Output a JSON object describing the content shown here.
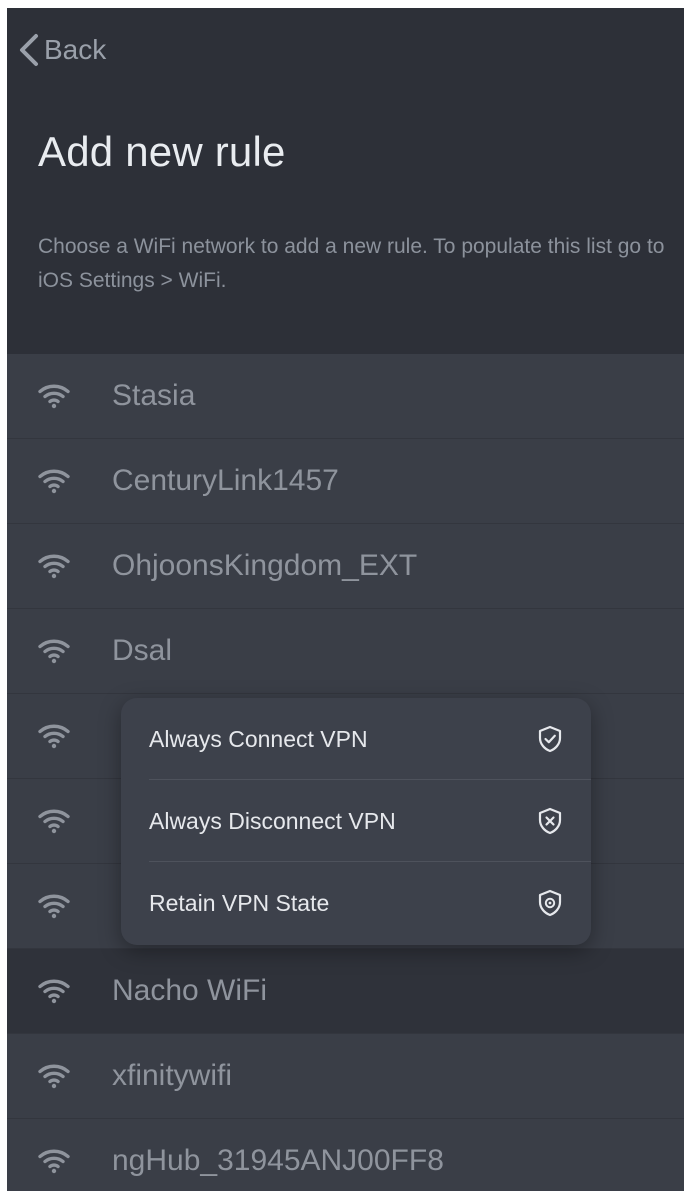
{
  "nav": {
    "back_label": "Back"
  },
  "header": {
    "title": "Add new rule",
    "subtitle": "Choose a WiFi network to add a new rule. To populate this list go to iOS Settings > WiFi."
  },
  "networks": [
    {
      "name": "Stasia",
      "icon": "wifi-icon"
    },
    {
      "name": "CenturyLink1457",
      "icon": "wifi-icon"
    },
    {
      "name": "OhjoonsKingdom_EXT",
      "icon": "wifi-icon"
    },
    {
      "name": "Dsal",
      "icon": "wifi-icon"
    },
    {
      "name": "",
      "icon": "wifi-icon"
    },
    {
      "name": "",
      "icon": "wifi-icon"
    },
    {
      "name": "",
      "icon": "wifi-icon"
    },
    {
      "name": "Nacho WiFi",
      "icon": "wifi-icon",
      "selected": true
    },
    {
      "name": "xfinitywifi",
      "icon": "wifi-icon"
    },
    {
      "name": "ngHub_31945ANJ00FF8",
      "icon": "wifi-icon"
    }
  ],
  "menu": {
    "items": [
      {
        "label": "Always Connect VPN",
        "icon": "shield-check-icon"
      },
      {
        "label": "Always Disconnect VPN",
        "icon": "shield-x-icon"
      },
      {
        "label": "Retain VPN State",
        "icon": "shield-gear-icon"
      }
    ]
  },
  "colors": {
    "background": "#2d3038",
    "row": "#3a3e47",
    "selected_row": "#2f323a",
    "menu": "#3d414b",
    "title": "#e9ecf0",
    "muted_text": "#8f949d"
  }
}
